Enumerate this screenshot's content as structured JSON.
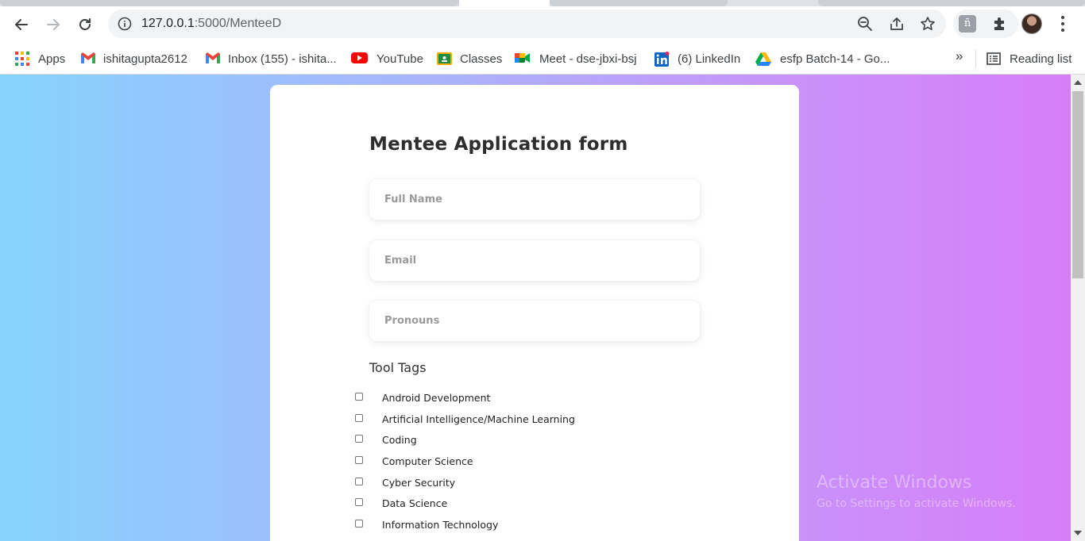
{
  "browser": {
    "url_host": "127.0.0.1",
    "url_path": ":5000/MenteeD",
    "bookmarks": [
      {
        "label": "Apps",
        "icon": "apps-grid-icon"
      },
      {
        "label": "ishitagupta2612",
        "icon": "gmail-icon"
      },
      {
        "label": "Inbox (155) - ishita...",
        "icon": "gmail-icon"
      },
      {
        "label": "YouTube",
        "icon": "youtube-icon"
      },
      {
        "label": "Classes",
        "icon": "google-classroom-icon"
      },
      {
        "label": "Meet - dse-jbxi-bsj",
        "icon": "google-meet-icon"
      },
      {
        "label": "(6) LinkedIn",
        "icon": "linkedin-icon"
      },
      {
        "label": "esfp Batch-14 - Go...",
        "icon": "google-drive-icon"
      }
    ],
    "bookmarks_more": "»",
    "reading_list": "Reading list"
  },
  "form": {
    "title": "Mentee Application form",
    "fields": {
      "full_name_placeholder": "Full Name",
      "email_placeholder": "Email",
      "pronouns_placeholder": "Pronouns"
    },
    "tool_tags_label": "Tool Tags",
    "tags": [
      "Android Development",
      "Artificial Intelligence/Machine Learning",
      "Coding",
      "Computer Science",
      "Cyber Security",
      "Data Science",
      "Information Technology"
    ]
  },
  "watermark": {
    "line1": "Activate Windows",
    "line2": "Go to Settings to activate Windows."
  },
  "colors": {
    "gradient_start": "#86d3fd",
    "gradient_end": "#d77ef7",
    "card": "#ffffff"
  }
}
